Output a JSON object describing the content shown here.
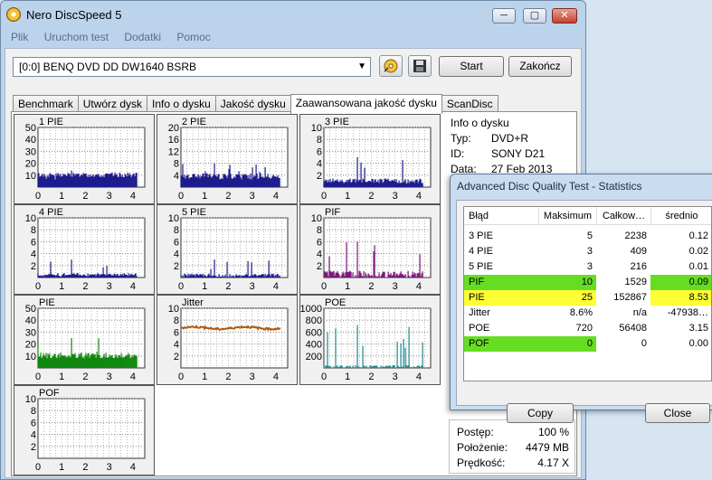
{
  "window": {
    "title": "Nero DiscSpeed 5",
    "controls": {
      "minimize": "─",
      "maximize": "▢",
      "close": "✕"
    }
  },
  "menu": [
    "Plik",
    "Uruchom test",
    "Dodatki",
    "Pomoc"
  ],
  "drive": {
    "selected": "[0:0]   BENQ DVD DD DW1640 BSRB"
  },
  "buttons": {
    "start": "Start",
    "exit": "Zakończ"
  },
  "tabs": [
    "Benchmark",
    "Utwórz dysk",
    "Info o dysku",
    "Jakość dysku",
    "Zaawansowana jakość dysku",
    "ScanDisc"
  ],
  "active_tab": "Zaawansowana jakość dysku",
  "disc_info": {
    "title": "Info o dysku",
    "rows": [
      {
        "label": "Typ:",
        "value": "DVD+R"
      },
      {
        "label": "ID:",
        "value": "SONY D21"
      },
      {
        "label": "Data:",
        "value": "27 Feb 2013"
      }
    ]
  },
  "status": {
    "rows": [
      {
        "label": "Postęp:",
        "value": "100 %"
      },
      {
        "label": "Położenie:",
        "value": "4479 MB"
      },
      {
        "label": "Prędkość:",
        "value": "4.17 X"
      }
    ]
  },
  "colors": {
    "pie_series": "#1c1c8c",
    "pif_series": "#7a1a7a",
    "pie_total": "#118811",
    "jitter": "#b05a10",
    "poe": "#1a8a8a",
    "grid": "#8a8a8a",
    "highlight_green": "#66dd22",
    "highlight_yellow": "#ffff33"
  },
  "chart_data": [
    {
      "type": "bar",
      "title": "1 PIE",
      "y_ticks": [
        "50",
        "40",
        "30",
        "20",
        "10"
      ],
      "ylim": [
        0,
        50
      ],
      "x_ticks": [
        "0",
        "1",
        "2",
        "3",
        "4"
      ],
      "xlim": [
        0,
        4.5
      ],
      "baseline": 9,
      "variation": 4,
      "peak": 14,
      "color": "#1c1c8c"
    },
    {
      "type": "bar",
      "title": "2 PIE",
      "y_ticks": [
        "20",
        "16",
        "12",
        "8",
        "4"
      ],
      "ylim": [
        0,
        20
      ],
      "x_ticks": [
        "0",
        "1",
        "2",
        "3",
        "4"
      ],
      "xlim": [
        0,
        4.5
      ],
      "baseline": 3,
      "variation": 2,
      "peak": 8,
      "color": "#1c1c8c"
    },
    {
      "type": "bar",
      "title": "3 PIE",
      "y_ticks": [
        "10",
        "8",
        "6",
        "4",
        "2"
      ],
      "ylim": [
        0,
        10
      ],
      "x_ticks": [
        "0",
        "1",
        "2",
        "3",
        "4"
      ],
      "xlim": [
        0,
        4.5
      ],
      "baseline": 0.8,
      "variation": 0.8,
      "peak": 5,
      "color": "#1c1c8c"
    },
    {
      "type": "bar",
      "title": "4 PIE",
      "y_ticks": [
        "10",
        "8",
        "6",
        "4",
        "2"
      ],
      "ylim": [
        0,
        10
      ],
      "x_ticks": [
        "0",
        "1",
        "2",
        "3",
        "4"
      ],
      "xlim": [
        0,
        4.5
      ],
      "baseline": 0.3,
      "variation": 0.6,
      "peak": 3,
      "color": "#1c1c8c"
    },
    {
      "type": "bar",
      "title": "5 PIE",
      "y_ticks": [
        "10",
        "8",
        "6",
        "4",
        "2"
      ],
      "ylim": [
        0,
        10
      ],
      "x_ticks": [
        "0",
        "1",
        "2",
        "3",
        "4"
      ],
      "xlim": [
        0,
        4.5
      ],
      "baseline": 0.2,
      "variation": 0.6,
      "peak": 3,
      "color": "#1c1c8c"
    },
    {
      "type": "bar",
      "title": "PIF",
      "y_ticks": [
        "10",
        "8",
        "6",
        "4",
        "2"
      ],
      "ylim": [
        0,
        10
      ],
      "x_ticks": [
        "0",
        "1",
        "2",
        "3",
        "4"
      ],
      "xlim": [
        0,
        4.5
      ],
      "baseline": 0.2,
      "variation": 1.2,
      "peak": 6,
      "color": "#7a1a7a"
    },
    {
      "type": "bar",
      "title": "PIE",
      "y_ticks": [
        "50",
        "40",
        "30",
        "20",
        "10"
      ],
      "ylim": [
        0,
        50
      ],
      "x_ticks": [
        "0",
        "1",
        "2",
        "3",
        "4"
      ],
      "xlim": [
        0,
        4.5
      ],
      "baseline": 9,
      "variation": 5,
      "peak": 25,
      "color": "#118811"
    },
    {
      "type": "line",
      "title": "Jitter",
      "y_ticks": [
        "10",
        "8",
        "6",
        "4",
        "2"
      ],
      "ylim": [
        0,
        10
      ],
      "x_ticks": [
        "0",
        "1",
        "2",
        "3",
        "4"
      ],
      "xlim": [
        0,
        4.5
      ],
      "baseline": 6.7,
      "variation": 0.3,
      "color": "#b05a10"
    },
    {
      "type": "bar",
      "title": "POE",
      "y_ticks": [
        "1000",
        "800",
        "600",
        "400",
        "200"
      ],
      "ylim": [
        0,
        1000
      ],
      "x_ticks": [
        "0",
        "1",
        "2",
        "3",
        "4"
      ],
      "xlim": [
        0,
        4.5
      ],
      "baseline": 0,
      "variation": 60,
      "peak": 720,
      "color": "#1a8a8a"
    },
    {
      "type": "bar",
      "title": "POF",
      "y_ticks": [
        "10",
        "8",
        "6",
        "4",
        "2"
      ],
      "ylim": [
        0,
        10
      ],
      "x_ticks": [
        "0",
        "1",
        "2",
        "3",
        "4"
      ],
      "xlim": [
        0,
        4.5
      ],
      "baseline": 0,
      "variation": 0,
      "peak": 0,
      "color": "#1c1c8c"
    }
  ],
  "stats_dialog": {
    "title": "Advanced Disc Quality Test - Statistics",
    "columns": [
      "Błąd",
      "Maksimum",
      "Całkow…",
      "średnio"
    ],
    "rows": [
      {
        "name": "3 PIE",
        "max": "5",
        "total": "2238",
        "avg": "0.12"
      },
      {
        "name": "4 PIE",
        "max": "3",
        "total": "409",
        "avg": "0.02"
      },
      {
        "name": "5 PIE",
        "max": "3",
        "total": "216",
        "avg": "0.01"
      },
      {
        "name": "PIF",
        "max": "10",
        "total": "1529",
        "avg": "0.09",
        "highlight": "green",
        "avg_highlight": "green"
      },
      {
        "name": "PIE",
        "max": "25",
        "total": "152867",
        "avg": "8.53",
        "highlight": "yellow",
        "avg_highlight": "yellow"
      },
      {
        "name": "Jitter",
        "max": "8.6%",
        "total": "n/a",
        "avg": "-47938…"
      },
      {
        "name": "POE",
        "max": "720",
        "total": "56408",
        "avg": "3.15"
      },
      {
        "name": "POF",
        "max": "0",
        "total": "0",
        "avg": "0.00",
        "highlight": "green"
      }
    ],
    "copy_label": "Copy",
    "close_label": "Close"
  }
}
